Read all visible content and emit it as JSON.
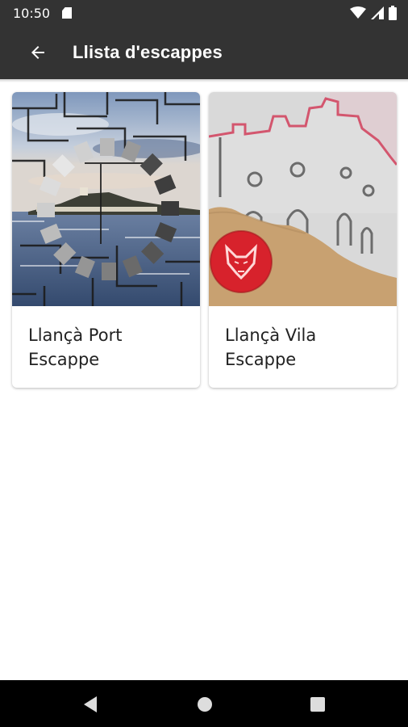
{
  "status_bar": {
    "time": "10:50",
    "icons": [
      "sd-card-icon",
      "wifi-icon",
      "cellular-signal-icon",
      "battery-icon"
    ]
  },
  "app_bar": {
    "title": "Llista d'escappes",
    "back_icon": "arrow-back-icon"
  },
  "escapes": [
    {
      "title": "Llançà Port Escappe",
      "image": "port-harbor-puzzle-image"
    },
    {
      "title": "Llançà Vila Escappe",
      "image": "vila-castle-wolf-image"
    }
  ],
  "nav_bar": {
    "icons": [
      "nav-back-icon",
      "nav-home-icon",
      "nav-recents-icon"
    ]
  },
  "colors": {
    "bar_background": "#333333",
    "nav_background": "#000000",
    "card_text": "#222222",
    "stamp_red": "#d7222c",
    "sand": "#c8a171"
  }
}
